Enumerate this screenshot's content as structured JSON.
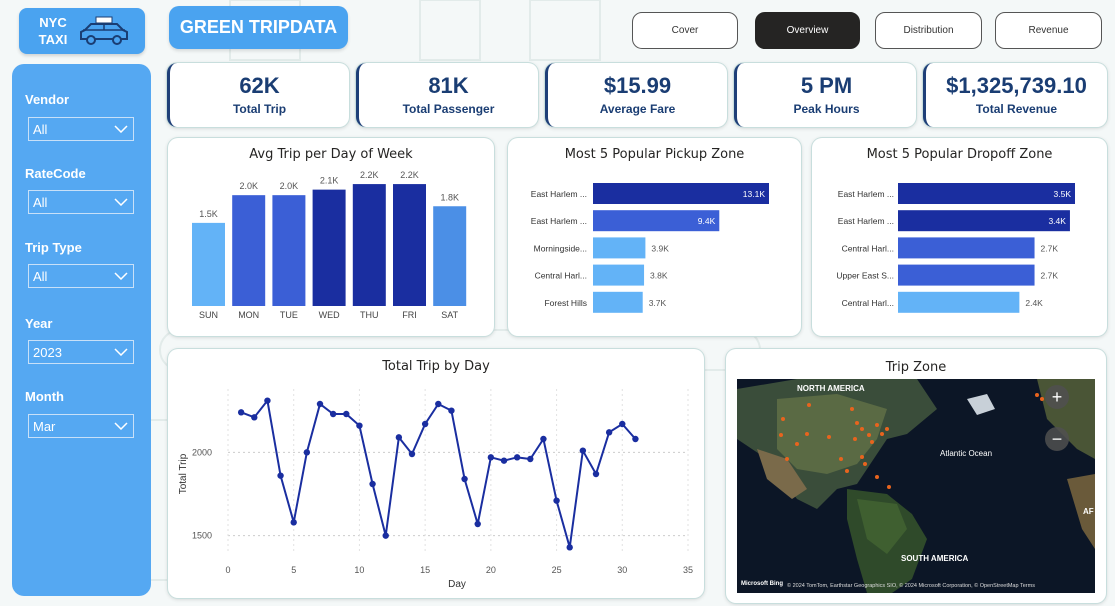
{
  "logo": {
    "line1": "NYC",
    "line2": "TAXI",
    "taxi_sign": "TAXI"
  },
  "page_title": "GREEN TRIPDATA",
  "nav": [
    {
      "label": "Cover"
    },
    {
      "label": "Overview"
    },
    {
      "label": "Distribution"
    },
    {
      "label": "Revenue"
    }
  ],
  "filters": [
    {
      "label": "Vendor",
      "value": "All"
    },
    {
      "label": "RateCode",
      "value": "All"
    },
    {
      "label": "Trip Type",
      "value": "All"
    },
    {
      "label": "Year",
      "value": "2023"
    },
    {
      "label": "Month",
      "value": "Mar"
    }
  ],
  "kpis": [
    {
      "value": "62K",
      "label": "Total Trip"
    },
    {
      "value": "81K",
      "label": "Total Passenger"
    },
    {
      "value": "$15.99",
      "label": "Average Fare"
    },
    {
      "value": "5 PM",
      "label": "Peak Hours"
    },
    {
      "value": "$1,325,739.10",
      "label": "Total Revenue"
    }
  ],
  "colors": {
    "dark_blue": "#1a2ea0",
    "mid_blue": "#3b5fd6",
    "light_blue": "#63b3f7",
    "kpi_text": "#1a3d73",
    "line": "#1a2ea0"
  },
  "chart_data": [
    {
      "type": "bar",
      "title": "Avg Trip per Day of Week",
      "categories": [
        "SUN",
        "MON",
        "TUE",
        "WED",
        "THU",
        "FRI",
        "SAT"
      ],
      "values": [
        1500,
        2000,
        2000,
        2100,
        2200,
        2200,
        1800
      ],
      "labels": [
        "1.5K",
        "2.0K",
        "2.0K",
        "2.1K",
        "2.2K",
        "2.2K",
        "1.8K"
      ],
      "ylim": [
        0,
        2400
      ]
    },
    {
      "type": "bar",
      "orientation": "horizontal",
      "title": "Most 5 Popular Pickup Zone",
      "categories": [
        "East Harlem ...",
        "East Harlem ...",
        "Morningside...",
        "Central Harl...",
        "Forest Hills"
      ],
      "values": [
        13100,
        9400,
        3900,
        3800,
        3700
      ],
      "labels": [
        "13.1K",
        "9.4K",
        "3.9K",
        "3.8K",
        "3.7K"
      ]
    },
    {
      "type": "bar",
      "orientation": "horizontal",
      "title": "Most 5 Popular Dropoff Zone",
      "categories": [
        "East Harlem ...",
        "East Harlem ...",
        "Central Harl...",
        "Upper East S...",
        "Central Harl..."
      ],
      "values": [
        3500,
        3400,
        2700,
        2700,
        2400
      ],
      "labels": [
        "3.5K",
        "3.4K",
        "2.7K",
        "2.7K",
        "2.4K"
      ]
    },
    {
      "type": "line",
      "title": "Total Trip by Day",
      "xlabel": "Day",
      "ylabel": "Total Trip",
      "x": [
        1,
        2,
        3,
        4,
        5,
        6,
        7,
        8,
        9,
        10,
        11,
        12,
        13,
        14,
        15,
        16,
        17,
        18,
        19,
        20,
        21,
        22,
        23,
        24,
        25,
        26,
        27,
        28,
        29,
        30,
        31
      ],
      "y": [
        2240,
        2210,
        2310,
        1860,
        1580,
        2000,
        2290,
        2230,
        2230,
        2160,
        1810,
        1500,
        2090,
        1990,
        2170,
        2290,
        2250,
        1840,
        1570,
        1970,
        1950,
        1970,
        1960,
        2080,
        1710,
        1430,
        2010,
        1870,
        2120,
        2170,
        2080
      ],
      "xlim": [
        0,
        35
      ],
      "xticks": [
        0,
        5,
        10,
        15,
        20,
        25,
        30,
        35
      ],
      "yticks": [
        1500,
        2000
      ],
      "ylim": [
        1390,
        2380
      ]
    }
  ],
  "map": {
    "title": "Trip Zone",
    "labels": [
      "NORTH AMERICA",
      "Atlantic Ocean",
      "SOUTH AMERICA",
      "AF"
    ],
    "attribution": "© 2024 TomTom, Earthstar Geographics SIO, © 2024 Microsoft Corporation, © OpenStreetMap Terms",
    "brand": "Microsoft Bing",
    "zoom_in": "+",
    "zoom_out": "−"
  }
}
